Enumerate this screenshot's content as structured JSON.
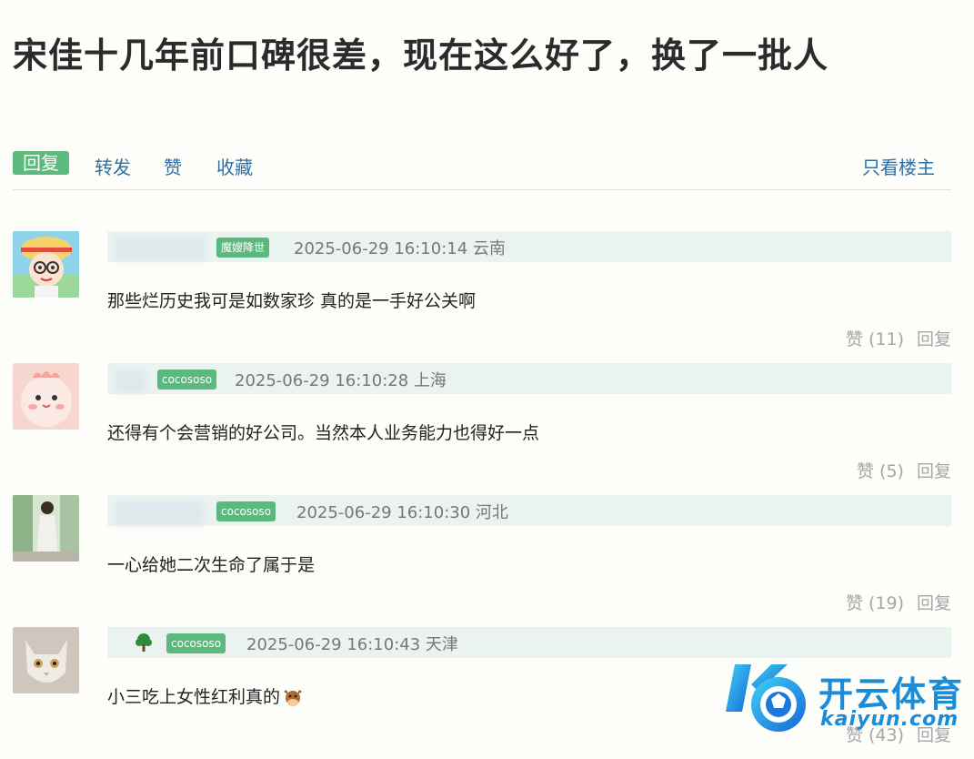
{
  "post": {
    "title": "宋佳十几年前口碑很差，现在这么好了，换了一批人"
  },
  "actions": {
    "reply": "回复",
    "forward": "转发",
    "like": "赞",
    "favorite": "收藏",
    "only_op": "只看楼主"
  },
  "comments": [
    {
      "badge": "魔嫂降世",
      "time": "2025-06-29 16:10:14 云南",
      "text": "那些烂历史我可是如数家珍 真的是一手好公关啊",
      "likes": "赞 (11)",
      "reply": "回复"
    },
    {
      "badge": "cocososo",
      "time": "2025-06-29 16:10:28 上海",
      "text": "还得有个会营销的好公司。当然本人业务能力也得好一点",
      "likes": "赞 (5)",
      "reply": "回复"
    },
    {
      "badge": "cocososo",
      "time": "2025-06-29 16:10:30 河北",
      "text": "一心给她二次生命了属于是",
      "likes": "赞 (19)",
      "reply": "回复"
    },
    {
      "badge": "cocososo",
      "time": "2025-06-29 16:10:43 天津",
      "text": "小三吃上女性红利真的",
      "likes": "赞 (43)",
      "reply": "回复"
    }
  ],
  "watermark": {
    "cn": "开云体育",
    "en": "kaiyun.com"
  },
  "colors": {
    "accent_green": "#5cba7d",
    "link_blue": "#2f6fa5",
    "meta_bg": "#ebf3f1"
  }
}
